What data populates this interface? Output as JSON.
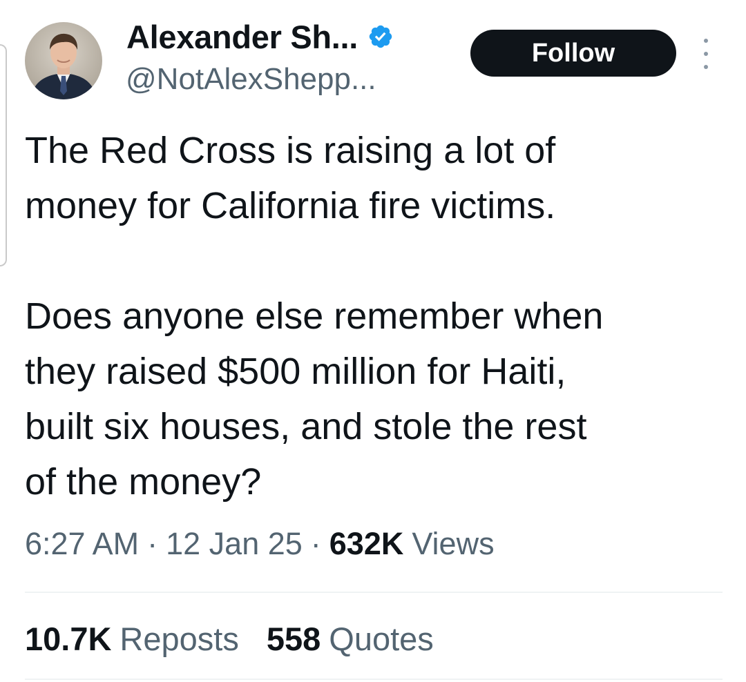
{
  "author": {
    "display_name": "Alexander Sh...",
    "handle": "@NotAlexShepp...",
    "verified": true,
    "avatar_icon": "profile-photo"
  },
  "actions": {
    "follow_label": "Follow",
    "more_icon": "more-vertical-icon"
  },
  "tweet": {
    "paragraphs": [
      [
        "The Red Cross is raising a lot of",
        "money for California fire victims."
      ],
      [
        "Does anyone else remember when",
        "they raised $500 million for Haiti,",
        "built six houses, and stole the rest",
        "of the money?"
      ]
    ]
  },
  "meta": {
    "time": "6:27 AM",
    "separator": "·",
    "date": "12 Jan 25",
    "views_count": "632K",
    "views_label": "Views"
  },
  "stats": {
    "reposts_count": "10.7K",
    "reposts_label": "Reposts",
    "quotes_count": "558",
    "quotes_label": "Quotes"
  },
  "colors": {
    "verified_blue": "#1d9bf0",
    "text_primary": "#0f1419",
    "text_secondary": "#536471",
    "follow_bg": "#0f1419"
  }
}
